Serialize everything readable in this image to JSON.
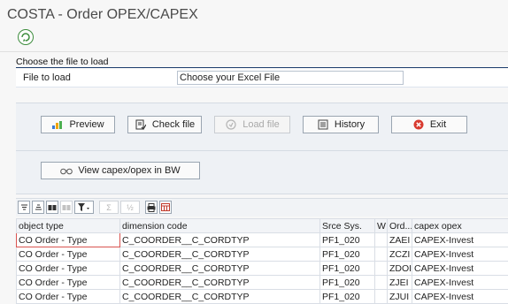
{
  "window": {
    "title": "COSTA - Order OPEX/CAPEX"
  },
  "section": {
    "header": "Choose the file to load"
  },
  "file": {
    "label": "File to load",
    "value": "Choose your Excel File"
  },
  "buttons": {
    "preview": "Preview",
    "check_file": "Check file",
    "load_file": "Load file",
    "history": "History",
    "exit": "Exit",
    "view_bw": "View capex/opex in BW"
  },
  "toolbar": {
    "sum": "Σ",
    "subtotal": "½"
  },
  "grid": {
    "columns": [
      "object type",
      "dimension code",
      "Srce Sys.",
      "W",
      "Ord...",
      "capex opex"
    ],
    "rows": [
      [
        "CO Order - Type",
        "C_COORDER__C_CORDTYP",
        "PF1_020",
        "",
        "ZAEI",
        "CAPEX-Invest"
      ],
      [
        "CO Order - Type",
        "C_COORDER__C_CORDTYP",
        "PF1_020",
        "",
        "ZCZI",
        "CAPEX-Invest"
      ],
      [
        "CO Order - Type",
        "C_COORDER__C_CORDTYP",
        "PF1_020",
        "",
        "ZDOI",
        "CAPEX-Invest"
      ],
      [
        "CO Order - Type",
        "C_COORDER__C_CORDTYP",
        "PF1_020",
        "",
        "ZJEI",
        "CAPEX-Invest"
      ],
      [
        "CO Order - Type",
        "C_COORDER__C_CORDTYP",
        "PF1_020",
        "",
        "ZJUI",
        "CAPEX-Invest"
      ]
    ]
  },
  "colors": {
    "exit_red": "#d83a2f",
    "exec_green": "#3c8c3c",
    "selection": "#d9534f",
    "section_line": "#1f3f6f"
  }
}
